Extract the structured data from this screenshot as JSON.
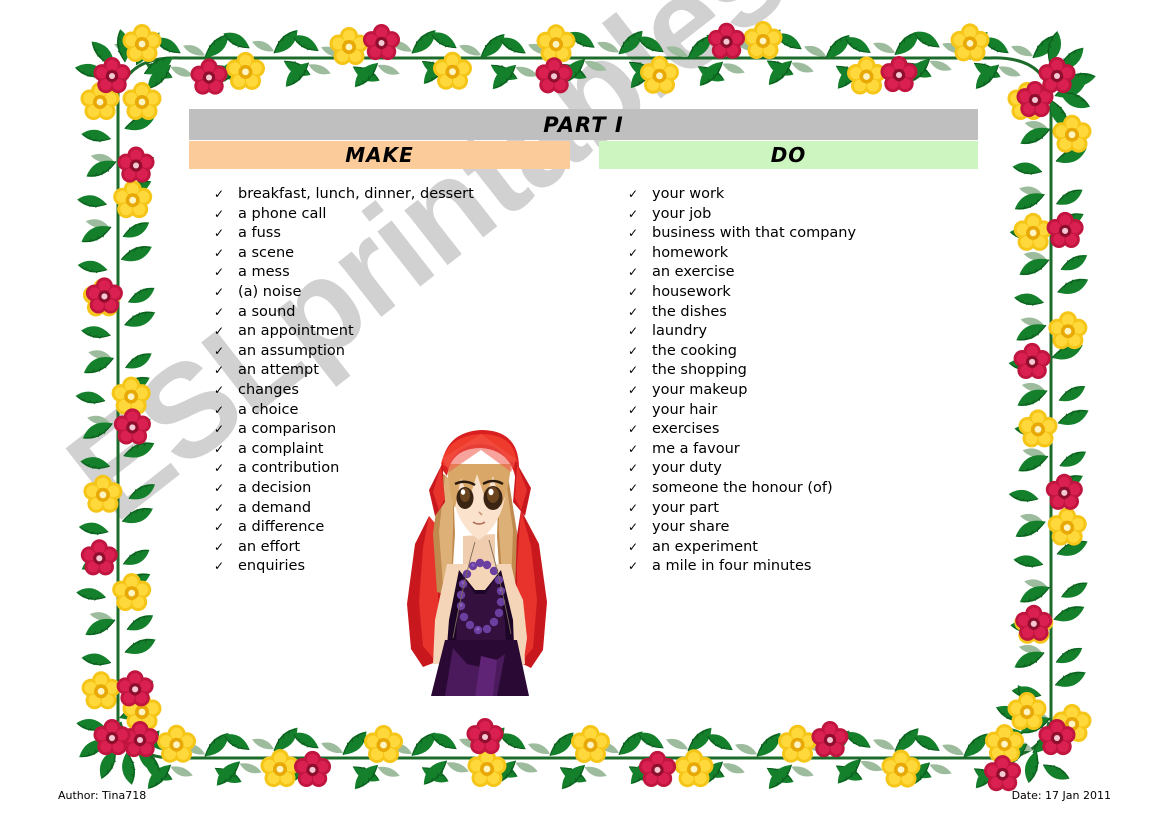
{
  "document": {
    "part_title": "PART I",
    "watermark": "ESLprintables.com"
  },
  "columns": {
    "make": {
      "heading": "MAKE",
      "heading_color": "#fbcb9a",
      "check_glyph": "✓",
      "items": [
        "breakfast, lunch, dinner, dessert",
        "a phone call",
        "a fuss",
        "a scene",
        "a mess",
        "(a) noise",
        "a sound",
        "an appointment",
        "an assumption",
        "an attempt",
        "changes",
        "a choice",
        "a comparison",
        "a complaint",
        "a contribution",
        "a decision",
        "a demand",
        "a difference",
        "an effort",
        "enquiries"
      ]
    },
    "do": {
      "heading": "DO",
      "heading_color": "#ccf5c0",
      "check_glyph": "✓",
      "items": [
        "your work",
        "your job",
        "business with that company",
        "homework",
        "an exercise",
        "housework",
        "the dishes",
        "laundry",
        "the cooking",
        "the shopping",
        "your makeup",
        "your hair",
        "exercises",
        "me a favour",
        "your duty",
        "someone the honour (of)",
        "your part",
        "your share",
        "an experiment",
        "a mile in four minutes"
      ]
    }
  },
  "illustration": {
    "name": "anime-girl-red-headscarf",
    "colors": {
      "scarf": "#d91f1f",
      "hair": "#c99a5e",
      "dress": "#3a1048",
      "beads": "#6b3fa0",
      "skin": "#f4d5b8"
    }
  },
  "footer": {
    "author": "Author: Tina718",
    "date": "Date: 17 Jan 2011"
  },
  "border": {
    "name": "floral-vine-border",
    "leaf_color": "#14802b",
    "leaf_dark": "#0c5c1e",
    "leaf_sage": "#9dbb9d",
    "flower_yellow": "#f5c518",
    "flower_yellow_dark": "#e0a908",
    "flower_red": "#c0153f",
    "flower_red_dark": "#8f0e2e",
    "stem_color": "#1d6b2a"
  },
  "part_bar_color": "#bfbfbf"
}
